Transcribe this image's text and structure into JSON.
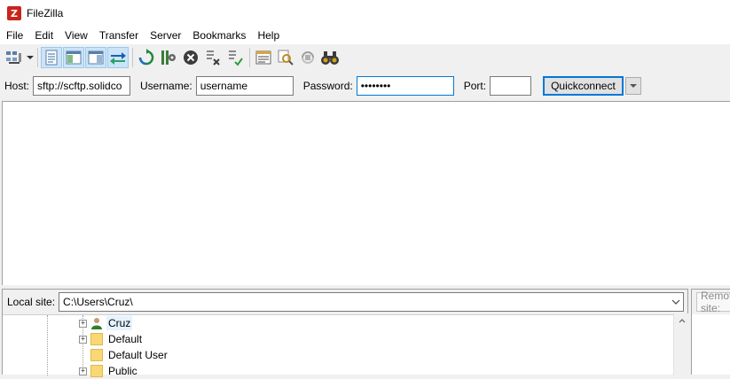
{
  "window": {
    "title": "FileZilla",
    "icon": "filezilla-icon"
  },
  "menu": {
    "items": [
      "File",
      "Edit",
      "View",
      "Transfer",
      "Server",
      "Bookmarks",
      "Help"
    ]
  },
  "toolbar": {
    "buttons": [
      "site-manager-icon",
      "site-manager-dropdown-icon",
      "toggle-message-log-icon",
      "toggle-local-tree-icon",
      "toggle-remote-tree-icon",
      "toggle-transfer-queue-icon",
      "refresh-icon",
      "process-queue-icon",
      "cancel-icon",
      "disconnect-icon",
      "reconnect-icon",
      "directory-listing-filters-icon",
      "filename-filter-icon",
      "sync-browsing-icon",
      "search-icon"
    ]
  },
  "quickconnect": {
    "host_label": "Host:",
    "host_value": "sftp://scftp.solidco",
    "username_label": "Username:",
    "username_value": "username",
    "password_label": "Password:",
    "password_value": "••••••••",
    "port_label": "Port:",
    "port_value": "",
    "button_label": "Quickconnect"
  },
  "local_site": {
    "label": "Local site:",
    "path": "C:\\Users\\Cruz\\",
    "tree": [
      {
        "name": "Cruz",
        "type": "user"
      },
      {
        "name": "Default",
        "type": "folder"
      },
      {
        "name": "Default User",
        "type": "folder"
      },
      {
        "name": "Public",
        "type": "folder"
      }
    ]
  },
  "remote_site": {
    "label": "Remote site:"
  },
  "colors": {
    "accent": "#0078d7",
    "selection": "#cce4f7",
    "folder": "#f8d775"
  }
}
